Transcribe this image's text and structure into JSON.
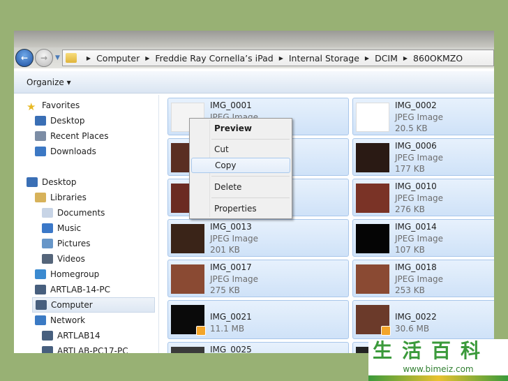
{
  "address_bar": {
    "crumbs": [
      "Computer",
      "Freddie Ray Cornella’s iPad",
      "Internal Storage",
      "DCIM",
      "860OKMZO"
    ]
  },
  "toolbar": {
    "organize_label": "Organize ▾"
  },
  "sidebar": {
    "items": [
      {
        "label": "Favorites",
        "icon": "star-icon"
      },
      {
        "label": "Desktop",
        "icon": "desktop-icon"
      },
      {
        "label": "Recent Places",
        "icon": "recent-places-icon"
      },
      {
        "label": "Downloads",
        "icon": "downloads-icon"
      },
      {
        "label": "Desktop",
        "icon": "desktop-icon"
      },
      {
        "label": "Libraries",
        "icon": "libraries-icon"
      },
      {
        "label": "Documents",
        "icon": "documents-icon"
      },
      {
        "label": "Music",
        "icon": "music-icon"
      },
      {
        "label": "Pictures",
        "icon": "pictures-icon"
      },
      {
        "label": "Videos",
        "icon": "videos-icon"
      },
      {
        "label": "Homegroup",
        "icon": "homegroup-icon"
      },
      {
        "label": "ARTLAB-14-PC",
        "icon": "computer-icon"
      },
      {
        "label": "Computer",
        "icon": "computer-icon",
        "selected": true
      },
      {
        "label": "Network",
        "icon": "network-icon"
      },
      {
        "label": "ARTLAB14",
        "icon": "computer-icon"
      },
      {
        "label": "ARTLAB-PC17-PC",
        "icon": "computer-icon"
      }
    ]
  },
  "files": [
    {
      "name": "IMG_0001",
      "type": "JPEG Image",
      "size": ""
    },
    {
      "name": "IMG_0002",
      "type": "JPEG Image",
      "size": "20.5 KB"
    },
    {
      "name": "",
      "type": "",
      "size": ""
    },
    {
      "name": "IMG_0006",
      "type": "JPEG Image",
      "size": "177 KB"
    },
    {
      "name": "",
      "type": "",
      "size": ""
    },
    {
      "name": "IMG_0010",
      "type": "JPEG Image",
      "size": "276 KB"
    },
    {
      "name": "IMG_0013",
      "type": "JPEG Image",
      "size": "201 KB"
    },
    {
      "name": "IMG_0014",
      "type": "JPEG Image",
      "size": "107 KB"
    },
    {
      "name": "IMG_0017",
      "type": "JPEG Image",
      "size": "275 KB"
    },
    {
      "name": "IMG_0018",
      "type": "JPEG Image",
      "size": "253 KB"
    },
    {
      "name": "IMG_0021",
      "type": "",
      "size": "11.1 MB",
      "video": true
    },
    {
      "name": "IMG_0022",
      "type": "",
      "size": "30.6 MB",
      "video": true
    },
    {
      "name": "IMG_0025",
      "type": "",
      "size": ""
    },
    {
      "name": "",
      "type": "",
      "size": ""
    }
  ],
  "context_menu": {
    "items": [
      "Preview",
      "Cut",
      "Copy",
      "Delete",
      "Properties"
    ],
    "highlighted": "Copy"
  },
  "watermark": {
    "text": "生活百科",
    "url": "www.bimeiz.com"
  }
}
